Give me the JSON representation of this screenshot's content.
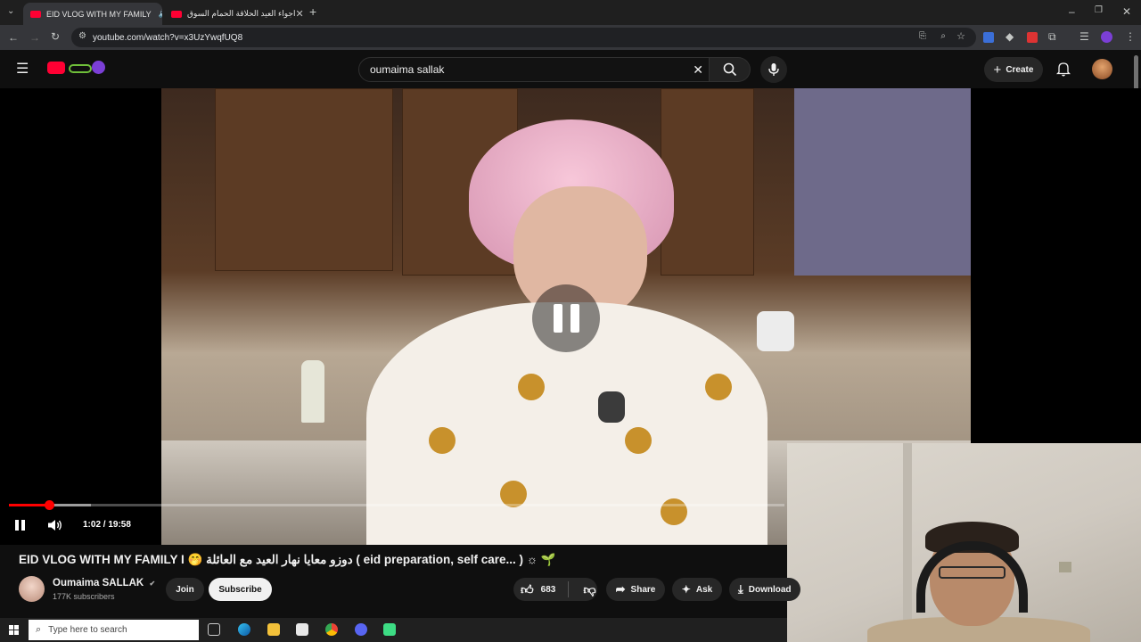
{
  "browser": {
    "tabs": [
      {
        "title": "EID VLOG WITH MY FAMILY",
        "active": true
      },
      {
        "title": "اجواء العيد الحلاقة الحمام السوق",
        "active": false
      }
    ],
    "new_tab": "+",
    "url": "youtube.com/watch?v=x3UzYwqfUQ8",
    "window_controls": {
      "minimize": "–",
      "restore": "❐",
      "close": "✕"
    }
  },
  "youtube": {
    "search_value": "oumaima sallak",
    "create_label": "Create",
    "player": {
      "time": "1:02 / 19:58",
      "progress_fraction": 0.052,
      "buffer_fraction": 0.106,
      "state": "playing"
    },
    "video": {
      "title": "EID VLOG WITH MY FAMILY I 🤭 دوزو معايا نهار العيد مع العائلة ( eid preparation, self care... ) ☼ 🌱",
      "channel_name": "Oumaima SALLAK",
      "verified_mark": "✔",
      "subscribers": "177K subscribers",
      "join_label": "Join",
      "subscribe_label": "Subscribe",
      "likes": "683",
      "share_label": "Share",
      "ask_label": "Ask",
      "download_label": "Download"
    }
  },
  "taskbar": {
    "search_placeholder": "Type here to search"
  },
  "colors": {
    "accent": "#ff0000",
    "background": "#0f0f0f"
  }
}
